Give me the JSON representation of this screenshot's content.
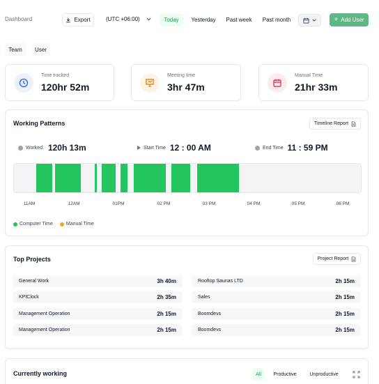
{
  "header": {
    "breadcrumb": "Dashboard",
    "export_label": "Export",
    "timezone": "(UTC +06:00)",
    "ranges": [
      "Today",
      "Yesterday",
      "Past week",
      "Past month"
    ],
    "active_range": "Today",
    "add_user_label": "Add User"
  },
  "view_toggle": [
    "Team",
    "User"
  ],
  "stats": [
    {
      "label": "Time tracked",
      "value": "120hr 52m",
      "icon": "clock-icon",
      "color": "#2563eb",
      "bg": "#eaf1fd"
    },
    {
      "label": "Meeting time",
      "value": "3hr 47m",
      "icon": "presentation-icon",
      "color": "#d97706",
      "bg": "#fdf3e4"
    },
    {
      "label": "Manual Time",
      "value": "21hr 33m",
      "icon": "calendar-icon",
      "color": "#e11d48",
      "bg": "#fdecee"
    }
  ],
  "working_patterns": {
    "title": "Working Patterns",
    "report_label": "Timeline Report",
    "worked_label": "Worked:",
    "worked_value": "120h 13m",
    "start_label": "Start Time",
    "start_value": "12 : 00 AM",
    "end_label": "End Time",
    "end_value": "11 : 59 PM",
    "hours": [
      "11AM",
      "12AM",
      "01PM",
      "02 PM",
      "03 PM",
      "04 PM",
      "05 PM",
      "06 PM"
    ],
    "segments_fraction": [
      [
        0.064,
        0.11
      ],
      [
        0.118,
        0.193
      ],
      [
        0.233,
        0.238
      ],
      [
        0.253,
        0.293
      ],
      [
        0.308,
        0.328
      ],
      [
        0.346,
        0.438
      ],
      [
        0.454,
        0.508
      ],
      [
        0.528,
        0.648
      ]
    ],
    "legend": [
      {
        "label": "Computer Time",
        "color": "#22c55e"
      },
      {
        "label": "Manual Time",
        "color": "#f5a524"
      }
    ]
  },
  "top_projects": {
    "title": "Top Projects",
    "report_label": "Project Report",
    "left": [
      {
        "name": "General Work",
        "time": "3h 40m"
      },
      {
        "name": "KPIClock",
        "time": "2h 35m"
      },
      {
        "name": "Management Operation",
        "time": "2h 15m"
      },
      {
        "name": "Management Operation",
        "time": "2h 15m"
      }
    ],
    "right": [
      {
        "name": "Rooftop Saunas LTD",
        "time": "2h 15m"
      },
      {
        "name": "Sales",
        "time": "2h 15m"
      },
      {
        "name": "Boomdevs",
        "time": "2h 15m"
      },
      {
        "name": "Boomdevs",
        "time": "2h 15m"
      }
    ]
  },
  "currently_working": {
    "title": "Currently working",
    "filters": [
      "All",
      "Productive",
      "Unproductive"
    ],
    "active_filter": "All"
  }
}
